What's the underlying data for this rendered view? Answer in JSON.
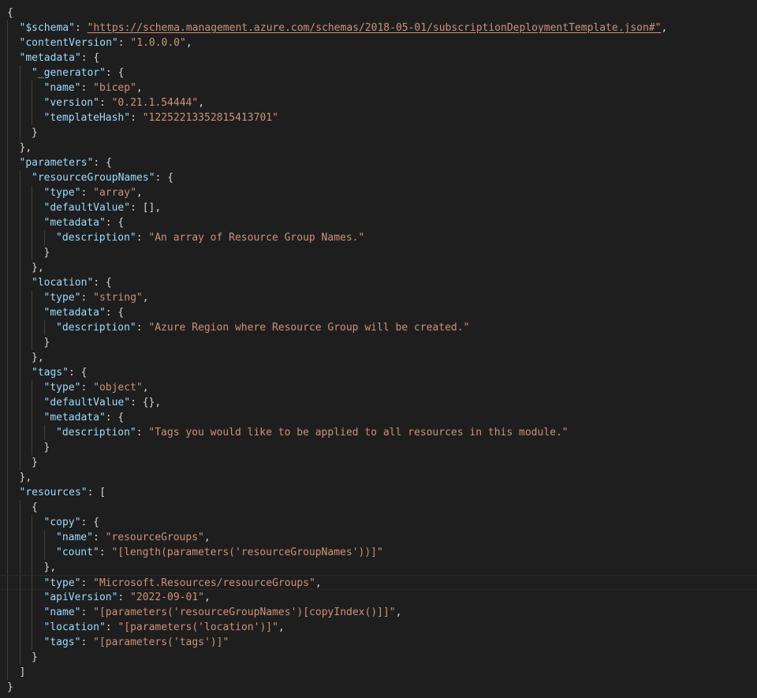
{
  "editor": {
    "language": "json",
    "theme": "dark",
    "colors": {
      "background": "#1e1e1e",
      "key": "#9cdcfe",
      "string": "#ce9178",
      "punctuation": "#d4d4d4",
      "indent_guide": "#404040",
      "current_line_border": "#282828"
    },
    "current_line": 38
  },
  "lines": [
    {
      "indent": 0,
      "segs": [
        [
          "pun",
          "{"
        ]
      ]
    },
    {
      "indent": 1,
      "segs": [
        [
          "key",
          "\"$schema\""
        ],
        [
          "pun",
          ": "
        ],
        [
          "url",
          "\"https://schema.management.azure.com/schemas/2018-05-01/subscriptionDeploymentTemplate.json#\""
        ],
        [
          "pun",
          ","
        ]
      ]
    },
    {
      "indent": 1,
      "segs": [
        [
          "key",
          "\"contentVersion\""
        ],
        [
          "pun",
          ": "
        ],
        [
          "str",
          "\"1.0.0.0\""
        ],
        [
          "pun",
          ","
        ]
      ]
    },
    {
      "indent": 1,
      "segs": [
        [
          "key",
          "\"metadata\""
        ],
        [
          "pun",
          ": {"
        ]
      ]
    },
    {
      "indent": 2,
      "segs": [
        [
          "key",
          "\"_generator\""
        ],
        [
          "pun",
          ": {"
        ]
      ]
    },
    {
      "indent": 3,
      "segs": [
        [
          "key",
          "\"name\""
        ],
        [
          "pun",
          ": "
        ],
        [
          "str",
          "\"bicep\""
        ],
        [
          "pun",
          ","
        ]
      ]
    },
    {
      "indent": 3,
      "segs": [
        [
          "key",
          "\"version\""
        ],
        [
          "pun",
          ": "
        ],
        [
          "str",
          "\"0.21.1.54444\""
        ],
        [
          "pun",
          ","
        ]
      ]
    },
    {
      "indent": 3,
      "segs": [
        [
          "key",
          "\"templateHash\""
        ],
        [
          "pun",
          ": "
        ],
        [
          "str",
          "\"12252213352815413701\""
        ]
      ]
    },
    {
      "indent": 2,
      "segs": [
        [
          "pun",
          "}"
        ]
      ]
    },
    {
      "indent": 1,
      "segs": [
        [
          "pun",
          "},"
        ]
      ]
    },
    {
      "indent": 1,
      "segs": [
        [
          "key",
          "\"parameters\""
        ],
        [
          "pun",
          ": {"
        ]
      ]
    },
    {
      "indent": 2,
      "segs": [
        [
          "key",
          "\"resourceGroupNames\""
        ],
        [
          "pun",
          ": {"
        ]
      ]
    },
    {
      "indent": 3,
      "segs": [
        [
          "key",
          "\"type\""
        ],
        [
          "pun",
          ": "
        ],
        [
          "str",
          "\"array\""
        ],
        [
          "pun",
          ","
        ]
      ]
    },
    {
      "indent": 3,
      "segs": [
        [
          "key",
          "\"defaultValue\""
        ],
        [
          "pun",
          ": [],"
        ]
      ]
    },
    {
      "indent": 3,
      "segs": [
        [
          "key",
          "\"metadata\""
        ],
        [
          "pun",
          ": {"
        ]
      ]
    },
    {
      "indent": 4,
      "segs": [
        [
          "key",
          "\"description\""
        ],
        [
          "pun",
          ": "
        ],
        [
          "str",
          "\"An array of Resource Group Names.\""
        ]
      ]
    },
    {
      "indent": 3,
      "segs": [
        [
          "pun",
          "}"
        ]
      ]
    },
    {
      "indent": 2,
      "segs": [
        [
          "pun",
          "},"
        ]
      ]
    },
    {
      "indent": 2,
      "segs": [
        [
          "key",
          "\"location\""
        ],
        [
          "pun",
          ": {"
        ]
      ]
    },
    {
      "indent": 3,
      "segs": [
        [
          "key",
          "\"type\""
        ],
        [
          "pun",
          ": "
        ],
        [
          "str",
          "\"string\""
        ],
        [
          "pun",
          ","
        ]
      ]
    },
    {
      "indent": 3,
      "segs": [
        [
          "key",
          "\"metadata\""
        ],
        [
          "pun",
          ": {"
        ]
      ]
    },
    {
      "indent": 4,
      "segs": [
        [
          "key",
          "\"description\""
        ],
        [
          "pun",
          ": "
        ],
        [
          "str",
          "\"Azure Region where Resource Group will be created.\""
        ]
      ]
    },
    {
      "indent": 3,
      "segs": [
        [
          "pun",
          "}"
        ]
      ]
    },
    {
      "indent": 2,
      "segs": [
        [
          "pun",
          "},"
        ]
      ]
    },
    {
      "indent": 2,
      "segs": [
        [
          "key",
          "\"tags\""
        ],
        [
          "pun",
          ": {"
        ]
      ]
    },
    {
      "indent": 3,
      "segs": [
        [
          "key",
          "\"type\""
        ],
        [
          "pun",
          ": "
        ],
        [
          "str",
          "\"object\""
        ],
        [
          "pun",
          ","
        ]
      ]
    },
    {
      "indent": 3,
      "segs": [
        [
          "key",
          "\"defaultValue\""
        ],
        [
          "pun",
          ": {},"
        ]
      ]
    },
    {
      "indent": 3,
      "segs": [
        [
          "key",
          "\"metadata\""
        ],
        [
          "pun",
          ": {"
        ]
      ]
    },
    {
      "indent": 4,
      "segs": [
        [
          "key",
          "\"description\""
        ],
        [
          "pun",
          ": "
        ],
        [
          "str",
          "\"Tags you would like to be applied to all resources in this module.\""
        ]
      ]
    },
    {
      "indent": 3,
      "segs": [
        [
          "pun",
          "}"
        ]
      ]
    },
    {
      "indent": 2,
      "segs": [
        [
          "pun",
          "}"
        ]
      ]
    },
    {
      "indent": 1,
      "segs": [
        [
          "pun",
          "},"
        ]
      ]
    },
    {
      "indent": 1,
      "segs": [
        [
          "key",
          "\"resources\""
        ],
        [
          "pun",
          ": ["
        ]
      ]
    },
    {
      "indent": 2,
      "segs": [
        [
          "pun",
          "{"
        ]
      ]
    },
    {
      "indent": 3,
      "segs": [
        [
          "key",
          "\"copy\""
        ],
        [
          "pun",
          ": {"
        ]
      ]
    },
    {
      "indent": 4,
      "segs": [
        [
          "key",
          "\"name\""
        ],
        [
          "pun",
          ": "
        ],
        [
          "str",
          "\"resourceGroups\""
        ],
        [
          "pun",
          ","
        ]
      ]
    },
    {
      "indent": 4,
      "segs": [
        [
          "key",
          "\"count\""
        ],
        [
          "pun",
          ": "
        ],
        [
          "str",
          "\"[length(parameters('resourceGroupNames'))]\""
        ]
      ]
    },
    {
      "indent": 3,
      "segs": [
        [
          "pun",
          "},"
        ]
      ]
    },
    {
      "indent": 3,
      "segs": [
        [
          "key",
          "\"type\""
        ],
        [
          "pun",
          ": "
        ],
        [
          "str",
          "\"Microsoft.Resources/resourceGroups\""
        ],
        [
          "pun",
          ","
        ]
      ]
    },
    {
      "indent": 3,
      "segs": [
        [
          "key",
          "\"apiVersion\""
        ],
        [
          "pun",
          ": "
        ],
        [
          "str",
          "\"2022-09-01\""
        ],
        [
          "pun",
          ","
        ]
      ]
    },
    {
      "indent": 3,
      "segs": [
        [
          "key",
          "\"name\""
        ],
        [
          "pun",
          ": "
        ],
        [
          "str",
          "\"[parameters('resourceGroupNames')[copyIndex()]]\""
        ],
        [
          "pun",
          ","
        ]
      ]
    },
    {
      "indent": 3,
      "segs": [
        [
          "key",
          "\"location\""
        ],
        [
          "pun",
          ": "
        ],
        [
          "str",
          "\"[parameters('location')]\""
        ],
        [
          "pun",
          ","
        ]
      ]
    },
    {
      "indent": 3,
      "segs": [
        [
          "key",
          "\"tags\""
        ],
        [
          "pun",
          ": "
        ],
        [
          "str",
          "\"[parameters('tags')]\""
        ]
      ]
    },
    {
      "indent": 2,
      "segs": [
        [
          "pun",
          "}"
        ]
      ]
    },
    {
      "indent": 1,
      "segs": [
        [
          "pun",
          "]"
        ]
      ]
    },
    {
      "indent": 0,
      "segs": [
        [
          "pun",
          "}"
        ]
      ]
    }
  ]
}
